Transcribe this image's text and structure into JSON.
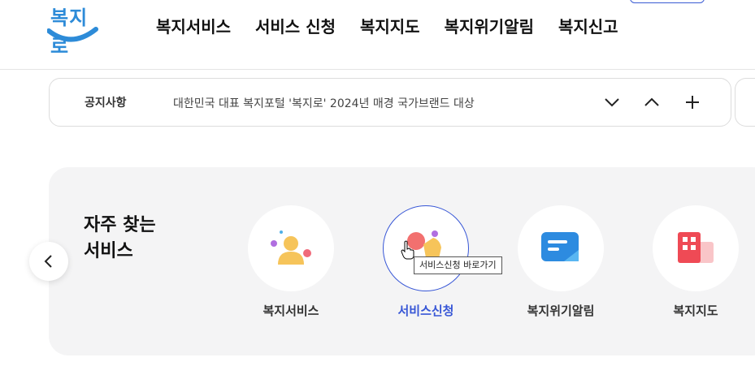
{
  "header": {
    "logo_text": "복지로",
    "nav": [
      {
        "label": "복지서비스"
      },
      {
        "label": "서비스 신청"
      },
      {
        "label": "복지지도"
      },
      {
        "label": "복지위기알림"
      },
      {
        "label": "복지신고"
      }
    ]
  },
  "notice": {
    "label": "공지사항",
    "text": "대한민국 대표 복지포털 '복지로' 2024년 매경 국가브랜드 대상",
    "controls": {
      "next_icon": "chevron-down-icon",
      "prev_icon": "chevron-up-icon",
      "more_icon": "plus-icon"
    }
  },
  "frequent_services": {
    "title_line1": "자주 찾는",
    "title_line2": "서비스",
    "prev_icon": "chevron-left-icon",
    "items": [
      {
        "label": "복지서비스",
        "icon": "person-icon",
        "active": false
      },
      {
        "label": "서비스신청",
        "icon": "hand-tap-icon",
        "active": true
      },
      {
        "label": "복지위기알림",
        "icon": "message-icon",
        "active": false
      },
      {
        "label": "복지지도",
        "icon": "building-icon",
        "active": false
      }
    ],
    "tooltip": "서비스신청 바로가기"
  },
  "colors": {
    "brand_blue": "#2d8bd8",
    "active_blue": "#3756d6",
    "panel_bg": "#f4f4f5"
  }
}
